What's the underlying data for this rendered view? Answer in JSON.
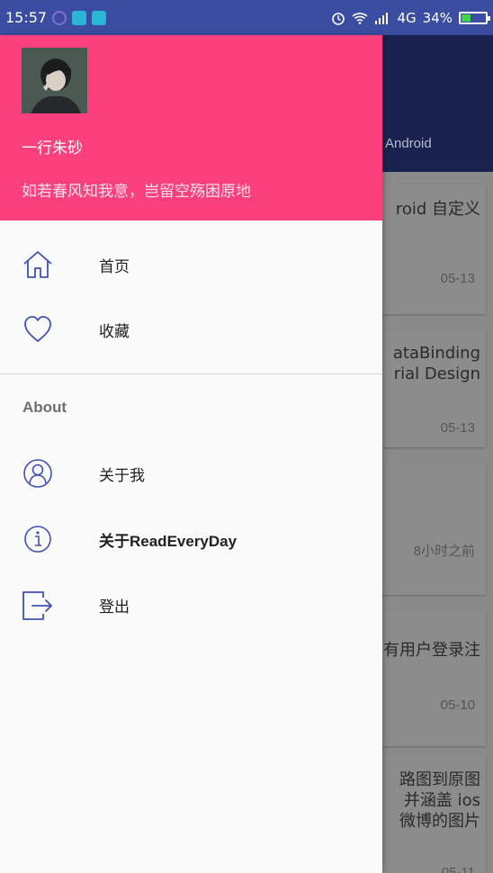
{
  "status_bar": {
    "time": "15:57",
    "network": "4G",
    "battery": "34%",
    "battery_level": 0.34
  },
  "background": {
    "tab_label": "Android",
    "cards": [
      {
        "title": "roid 自定义",
        "date": "05-13"
      },
      {
        "title": "ataBinding\nrial Design",
        "date": "05-13"
      },
      {
        "title": "",
        "date": "8小时之前"
      },
      {
        "title": "有用户登录注",
        "date": "05-10"
      },
      {
        "title": "路图到原图\n并涵盖 ios\n微博的图片",
        "date": "05-11"
      }
    ]
  },
  "drawer": {
    "username": "一行朱砂",
    "motto": "如若春风知我意，岂留空殇困原地",
    "menu": [
      {
        "icon": "home-icon",
        "label": "首页"
      },
      {
        "icon": "heart-icon",
        "label": "收藏"
      }
    ],
    "section_title": "About",
    "about_menu": [
      {
        "icon": "user-icon",
        "label": "关于我"
      },
      {
        "icon": "info-icon",
        "label": "关于ReadEveryDay"
      },
      {
        "icon": "logout-icon",
        "label": "登出"
      }
    ]
  },
  "colors": {
    "status_bar": "#3a4da1",
    "header": "#fc3f7d",
    "icon_tint": "#3f51b5"
  }
}
